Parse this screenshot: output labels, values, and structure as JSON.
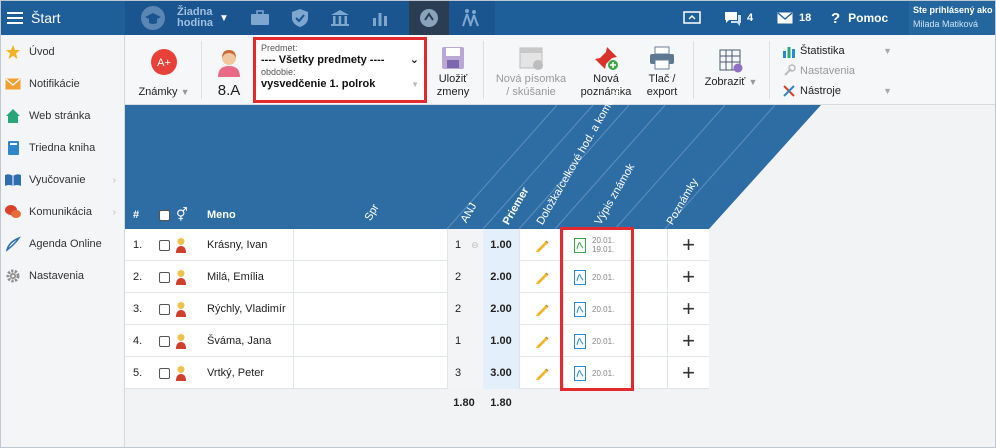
{
  "topbar": {
    "start_label": "Štart",
    "lesson_label_1": "Žiadna",
    "lesson_label_2": "hodina",
    "messages_count": "4",
    "notifications_count": "18",
    "help_label": "Pomoc",
    "logged_in_label": "Ste prihlásený ako",
    "user_name": "Milada Matiková"
  },
  "sidebar": {
    "items": [
      {
        "label": "Úvod"
      },
      {
        "label": "Notifikácie"
      },
      {
        "label": "Web stránka"
      },
      {
        "label": "Triedna kniha"
      },
      {
        "label": "Vyučovanie"
      },
      {
        "label": "Komunikácia"
      },
      {
        "label": "Agenda Online"
      },
      {
        "label": "Nastavenia"
      }
    ]
  },
  "toolbar": {
    "grades_label": "Známky",
    "grades_icon_text": "A+",
    "class_label": "8.A",
    "subject_label": "Predmet:",
    "subject_value": "---- Všetky predmety ----",
    "period_label": "obdobie:",
    "period_value": "vysvedčenie 1. polrok",
    "save_label_1": "Uložiť",
    "save_label_2": "zmeny",
    "new_test_label_1": "Nová písomka",
    "new_test_label_2": "/ skúšanie",
    "new_note_label_1": "Nová",
    "new_note_label_2": "poznámka",
    "print_label_1": "Tlač /",
    "print_label_2": "export",
    "view_label": "Zobraziť",
    "stats_label": "Štatistika",
    "settings_label": "Nastavenia",
    "tools_label": "Nástroje"
  },
  "table": {
    "headers": {
      "num": "#",
      "name": "Meno",
      "spr": "Spr",
      "anj": "ANJ",
      "avg": "Priemer",
      "extra": "Doložka/celkové hod. a komentár",
      "extract": "Výpis známok",
      "notes": "Poznámky"
    },
    "rows": [
      {
        "num": "1.",
        "name": "Krásny, Ivan",
        "grade": "1",
        "avg": "1.00",
        "date1": "20.01.",
        "date2": "19.01."
      },
      {
        "num": "2.",
        "name": "Milá, Emília",
        "grade": "2",
        "avg": "2.00",
        "date1": "20.01.",
        "date2": ""
      },
      {
        "num": "3.",
        "name": "Rýchly, Vladimír",
        "grade": "2",
        "avg": "2.00",
        "date1": "20.01.",
        "date2": ""
      },
      {
        "num": "4.",
        "name": "Šváma, Jana",
        "grade": "1",
        "avg": "1.00",
        "date1": "20.01.",
        "date2": ""
      },
      {
        "num": "5.",
        "name": "Vrtký, Peter",
        "grade": "3",
        "avg": "3.00",
        "date1": "20.01.",
        "date2": ""
      }
    ],
    "total_grade_avg": "1.80",
    "total_avg": "1.80"
  },
  "colors": {
    "topbar": "#1e5f99",
    "header_blue": "#2e6da4",
    "highlight_red": "#e32a2f",
    "average_bg": "#e3effa"
  }
}
